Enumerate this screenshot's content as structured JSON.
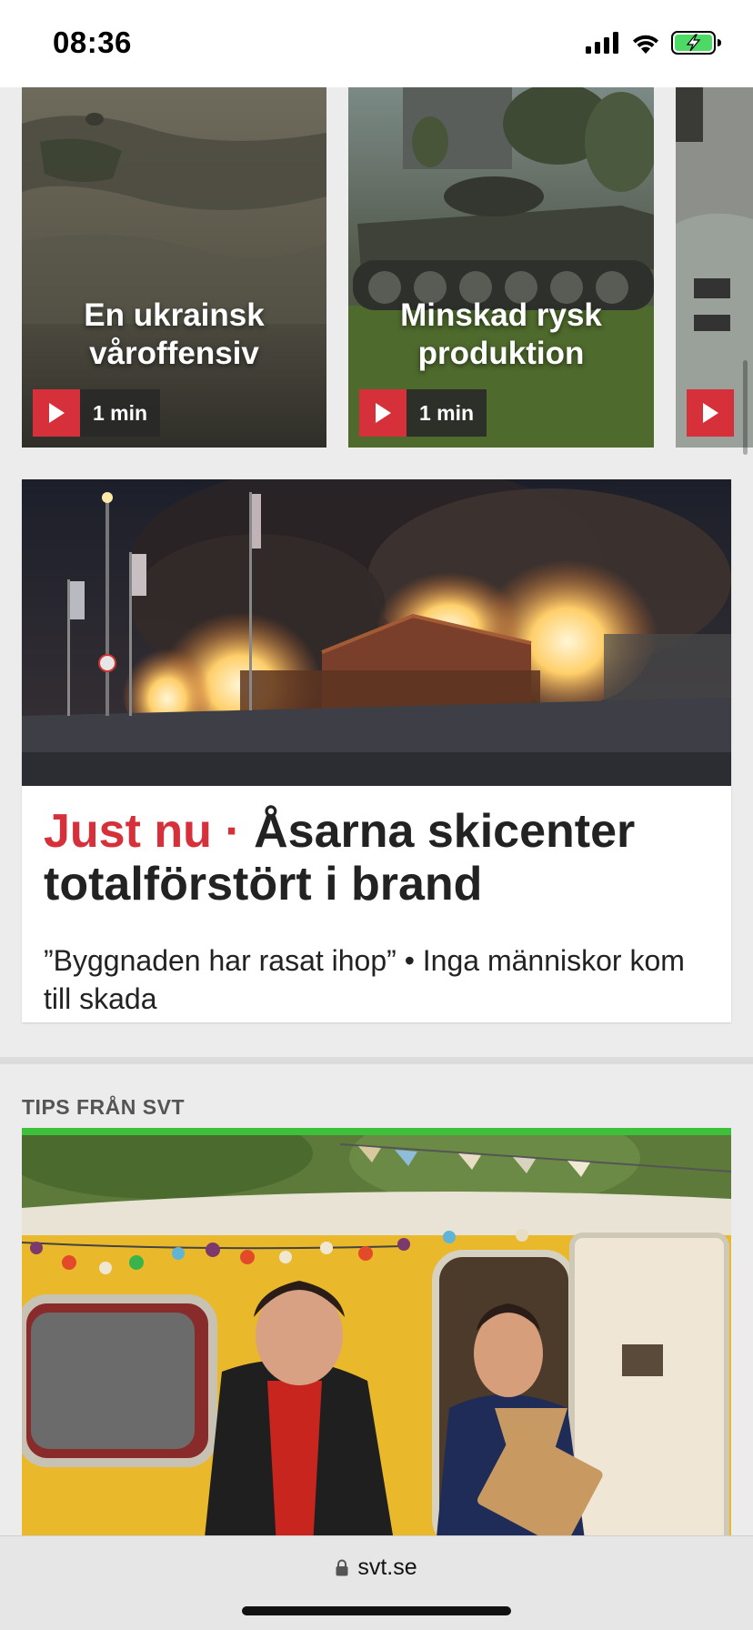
{
  "status_bar": {
    "time": "08:36",
    "icons": [
      "signal-icon",
      "wifi-icon",
      "battery-charging-icon"
    ],
    "battery_color": "#4cd964"
  },
  "video_row": {
    "items": [
      {
        "title": "En ukrainsk våroffensiv",
        "duration": "1 min"
      },
      {
        "title": "Minskad rysk produktion",
        "duration": "1 min"
      },
      {
        "title": "",
        "duration": ""
      }
    ]
  },
  "main_article": {
    "kicker": "Just nu",
    "separator": " · ",
    "headline": "Åsarna skicenter totalförstört i brand",
    "subtext": "”Byggnaden har rasat ihop” • Inga människor kom till skada"
  },
  "tips_section": {
    "label": "TIPS FRÅN SVT"
  },
  "browser": {
    "url": "svt.se"
  },
  "colors": {
    "accent_red": "#d6303a",
    "promo_green": "#3ec13a",
    "promo_yellow": "#e7b92d"
  }
}
